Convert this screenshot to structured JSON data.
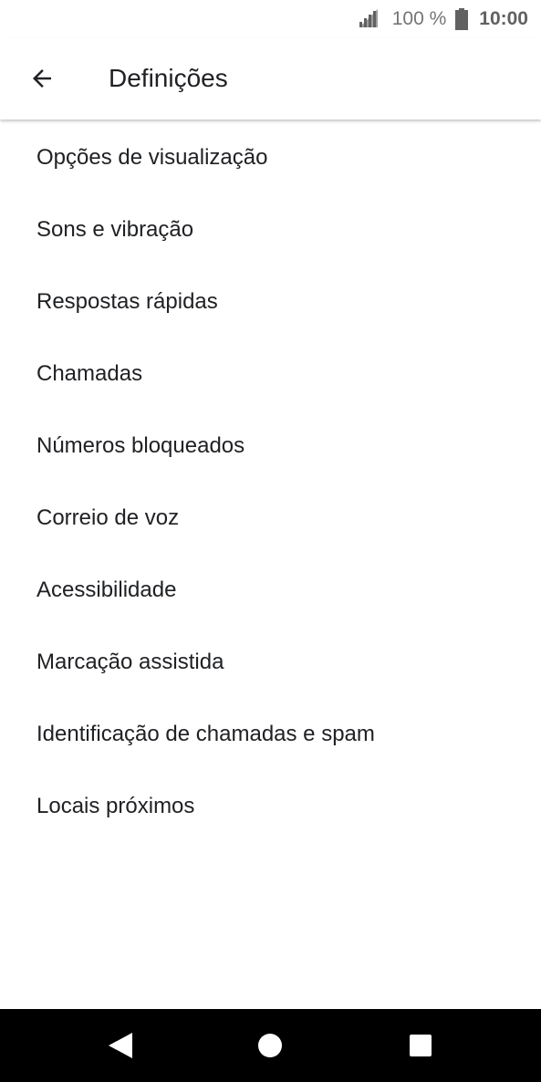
{
  "status_bar": {
    "battery_percent": "100 %",
    "time": "10:00",
    "icons": [
      "signal-icon",
      "battery-icon"
    ]
  },
  "app_bar": {
    "title": "Definições",
    "back_icon": "arrow-left-icon"
  },
  "settings": {
    "items": [
      {
        "label": "Opções de visualização"
      },
      {
        "label": "Sons e vibração"
      },
      {
        "label": "Respostas rápidas"
      },
      {
        "label": "Chamadas"
      },
      {
        "label": "Números bloqueados"
      },
      {
        "label": "Correio de voz"
      },
      {
        "label": "Acessibilidade"
      },
      {
        "label": "Marcação assistida"
      },
      {
        "label": "Identificação de chamadas e spam"
      },
      {
        "label": "Locais próximos"
      }
    ]
  },
  "nav_bar": {
    "icons": [
      "nav-back-icon",
      "nav-home-icon",
      "nav-recents-icon"
    ]
  },
  "colors": {
    "background": "#ffffff",
    "text_primary": "#202124",
    "status_text": "#757575",
    "nav_background": "#000000"
  }
}
